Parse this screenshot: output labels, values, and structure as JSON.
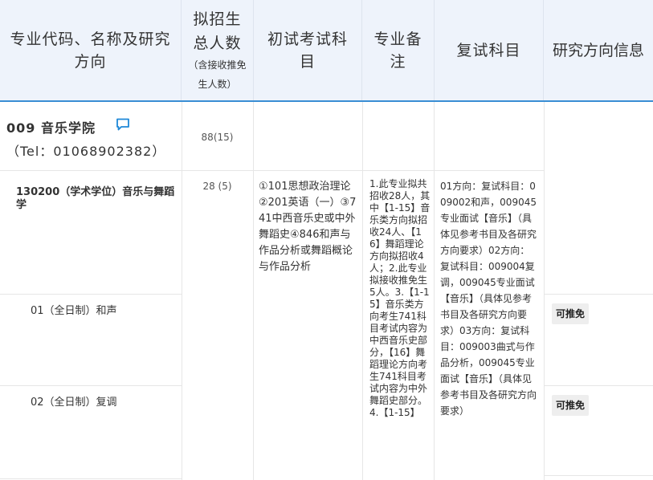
{
  "headers": {
    "col1": "专业代码、名称及研究方向",
    "col2_main": "拟招生总人数",
    "col2_sub": "（含接收推免生人数）",
    "col3": "初试考试科目",
    "col4": "专业备注",
    "col5": "复试科目",
    "col6": "研究方向信息"
  },
  "department": {
    "name": "009 音乐学院",
    "tel": "（Tel：01068902382）",
    "count": "88(15)",
    "icon": "chat-bubble-icon"
  },
  "major": {
    "name": "130200（学术学位）音乐与舞蹈学",
    "count": "28 (5)",
    "exam_subjects": "①101思想政治理论②201英语（一）③741中西音乐史或中外舞蹈史④846和声与作品分析或舞蹈概论与作品分析",
    "note": "1.此专业拟共招收28人，其中【1-15】音乐类方向拟招收24人、【16】舞蹈理论方向拟招收4人；2.此专业拟接收推免生5人。3.【1-15】音乐类方向考生741科目考试内容为中西音乐史部分，【16】舞蹈理论方向考生741科目考试内容为中外舞蹈史部分。4.【1-15】",
    "retest": "01方向：复试科目：009002和声，009045专业面试【音乐】（具体见参考书目及各研究方向要求）02方向：复试科目：009004复调，009045专业面试【音乐】（具体见参考书目及各研究方向要求）03方向：复试科目：009003曲式与作品分析，009045专业面试【音乐】（具体见参考书目及各研究方向要求）"
  },
  "directions": [
    {
      "name": "01（全日制）和声",
      "badge": "可推免"
    },
    {
      "name": "02（全日制）复调",
      "badge": "可推免"
    }
  ]
}
